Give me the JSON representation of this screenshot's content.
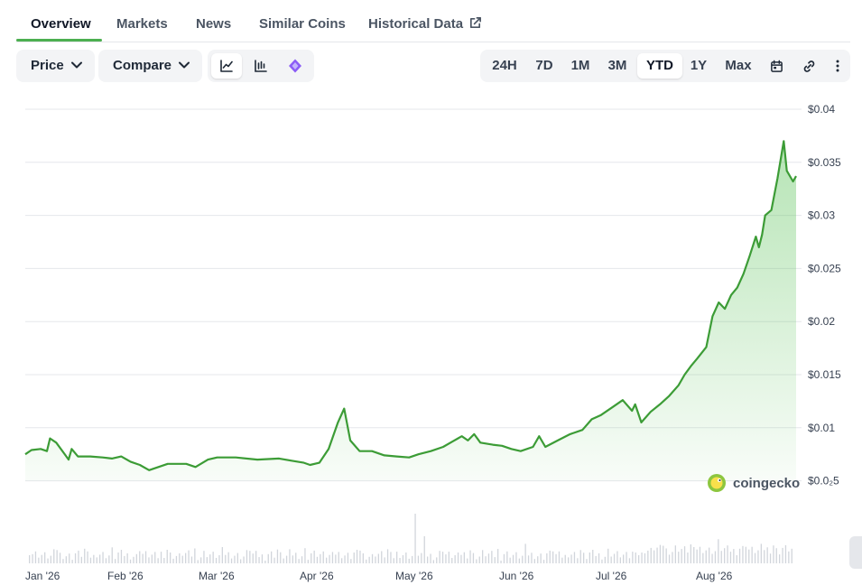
{
  "tabs": {
    "overview": "Overview",
    "markets": "Markets",
    "news": "News",
    "similar": "Similar Coins",
    "historical": "Historical Data"
  },
  "toolbar": {
    "price_label": "Price",
    "compare_label": "Compare",
    "ranges": [
      "24H",
      "7D",
      "1M",
      "3M",
      "YTD",
      "1Y",
      "Max"
    ],
    "active_range": "YTD"
  },
  "watermark": "coingecko",
  "colors": {
    "accent": "#4caf50",
    "line": "#3c9c36",
    "fill": "#5cc35a",
    "volume": "#d1d5db"
  },
  "chart_data": {
    "type": "area",
    "y_ticks": [
      "$0.04",
      "$0.035",
      "$0.03",
      "$0.025",
      "$0.02",
      "$0.015",
      "$0.01",
      "$0.0₂5"
    ],
    "ylim": [
      0.005,
      0.04
    ],
    "x_ticks": [
      "Jan '26",
      "Feb '26",
      "Mar '26",
      "Apr '26",
      "May '26",
      "Jun '26",
      "Jul '26",
      "Aug '26"
    ],
    "series": [
      {
        "name": "",
        "points": [
          [
            "Jan 01",
            0.0075
          ],
          [
            "Jan 03",
            0.0079
          ],
          [
            "Jan 06",
            0.008
          ],
          [
            "Jan 08",
            0.0078
          ],
          [
            "Jan 09",
            0.009
          ],
          [
            "Jan 11",
            0.0086
          ],
          [
            "Jan 14",
            0.0074
          ],
          [
            "Jan 15",
            0.007
          ],
          [
            "Jan 16",
            0.008
          ],
          [
            "Jan 18",
            0.0073
          ],
          [
            "Jan 22",
            0.0073
          ],
          [
            "Jan 26",
            0.0072
          ],
          [
            "Jan 29",
            0.0071
          ],
          [
            "Feb 01",
            0.0073
          ],
          [
            "Feb 04",
            0.0068
          ],
          [
            "Feb 07",
            0.0065
          ],
          [
            "Feb 10",
            0.006
          ],
          [
            "Feb 13",
            0.0063
          ],
          [
            "Feb 16",
            0.0066
          ],
          [
            "Feb 22",
            0.0066
          ],
          [
            "Feb 25",
            0.0063
          ],
          [
            "Mar 01",
            0.007
          ],
          [
            "Mar 04",
            0.0072
          ],
          [
            "Mar 10",
            0.0072
          ],
          [
            "Mar 17",
            0.007
          ],
          [
            "Mar 24",
            0.0071
          ],
          [
            "Mar 28",
            0.0069
          ],
          [
            "Apr 01",
            0.0067
          ],
          [
            "Apr 03",
            0.0065
          ],
          [
            "Apr 06",
            0.0067
          ],
          [
            "Apr 09",
            0.008
          ],
          [
            "Apr 12",
            0.0105
          ],
          [
            "Apr 14",
            0.0118
          ],
          [
            "Apr 16",
            0.0088
          ],
          [
            "Apr 19",
            0.0078
          ],
          [
            "Apr 23",
            0.0078
          ],
          [
            "Apr 27",
            0.0074
          ],
          [
            "May 01",
            0.0073
          ],
          [
            "May 05",
            0.0072
          ],
          [
            "May 08",
            0.0075
          ],
          [
            "May 12",
            0.0078
          ],
          [
            "May 16",
            0.0082
          ],
          [
            "May 19",
            0.0087
          ],
          [
            "May 22",
            0.0092
          ],
          [
            "May 24",
            0.0088
          ],
          [
            "May 26",
            0.0094
          ],
          [
            "May 28",
            0.0086
          ],
          [
            "Jun 01",
            0.0084
          ],
          [
            "Jun 04",
            0.0083
          ],
          [
            "Jun 07",
            0.008
          ],
          [
            "Jun 10",
            0.0078
          ],
          [
            "Jun 14",
            0.0082
          ],
          [
            "Jun 16",
            0.0092
          ],
          [
            "Jun 18",
            0.0082
          ],
          [
            "Jun 22",
            0.0088
          ],
          [
            "Jun 26",
            0.0094
          ],
          [
            "Jun 30",
            0.0098
          ],
          [
            "Jul 03",
            0.0108
          ],
          [
            "Jul 06",
            0.0112
          ],
          [
            "Jul 10",
            0.012
          ],
          [
            "Jul 13",
            0.0126
          ],
          [
            "Jul 16",
            0.0116
          ],
          [
            "Jul 17",
            0.0122
          ],
          [
            "Jul 19",
            0.0105
          ],
          [
            "Jul 22",
            0.0115
          ],
          [
            "Jul 25",
            0.0122
          ],
          [
            "Jul 28",
            0.013
          ],
          [
            "Jul 31",
            0.014
          ],
          [
            "Aug 02",
            0.015
          ],
          [
            "Aug 04",
            0.0158
          ],
          [
            "Aug 06",
            0.0165
          ],
          [
            "Aug 09",
            0.0176
          ],
          [
            "Aug 11",
            0.0205
          ],
          [
            "Aug 13",
            0.0218
          ],
          [
            "Aug 15",
            0.0212
          ],
          [
            "Aug 17",
            0.0225
          ],
          [
            "Aug 19",
            0.0232
          ],
          [
            "Aug 21",
            0.0245
          ],
          [
            "Aug 23",
            0.0262
          ],
          [
            "Aug 25",
            0.028
          ],
          [
            "Aug 26",
            0.027
          ],
          [
            "Aug 27",
            0.0282
          ],
          [
            "Aug 28",
            0.03
          ],
          [
            "Aug 30",
            0.0305
          ],
          [
            "Sep 01",
            0.0335
          ],
          [
            "Sep 03",
            0.037
          ],
          [
            "Sep 04",
            0.0342
          ],
          [
            "Sep 06",
            0.0332
          ],
          [
            "Sep 07",
            0.0337
          ]
        ]
      }
    ],
    "grid": true
  }
}
